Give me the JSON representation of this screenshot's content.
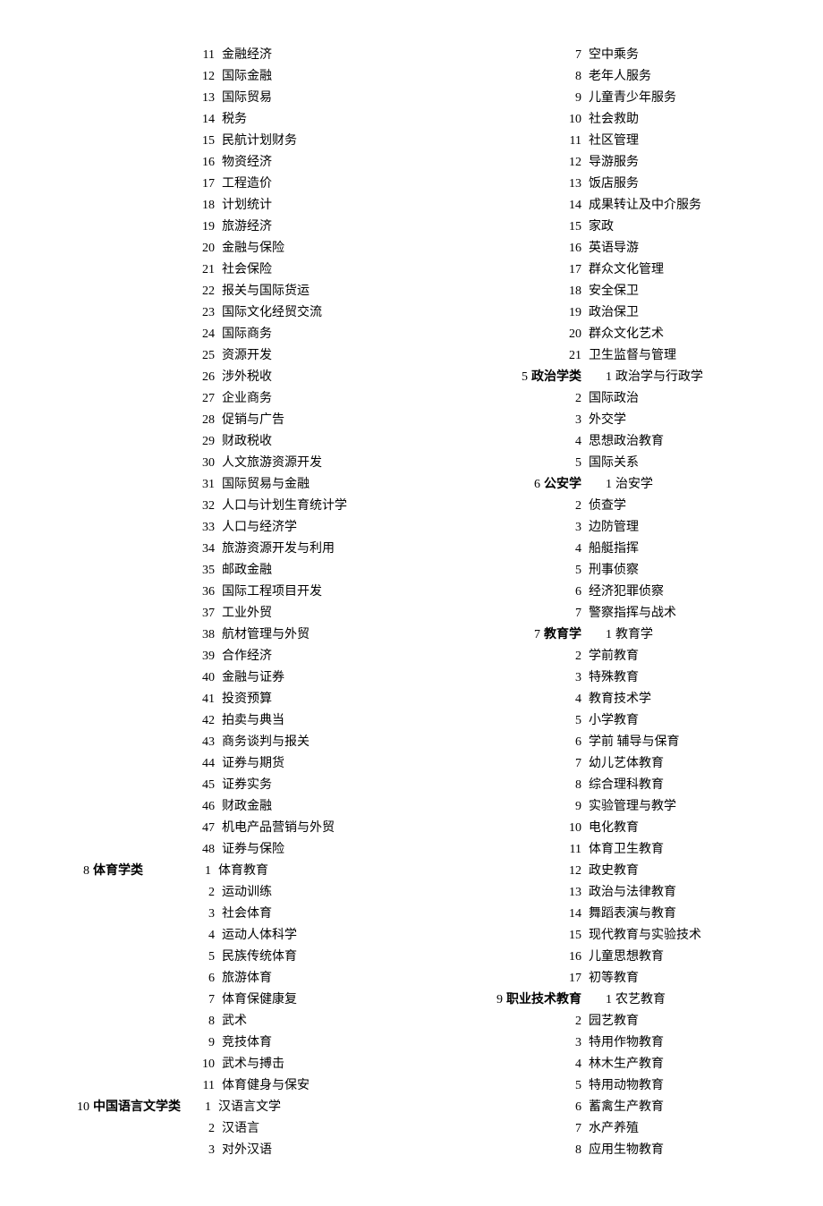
{
  "leftColumn": [
    {
      "type": "item",
      "num": "11",
      "name": "金融经济"
    },
    {
      "type": "item",
      "num": "12",
      "name": "国际金融"
    },
    {
      "type": "item",
      "num": "13",
      "name": "国际贸易"
    },
    {
      "type": "item",
      "num": "14",
      "name": "税务"
    },
    {
      "type": "item",
      "num": "15",
      "name": "民航计划财务"
    },
    {
      "type": "item",
      "num": "16",
      "name": "物资经济"
    },
    {
      "type": "item",
      "num": "17",
      "name": "工程造价"
    },
    {
      "type": "item",
      "num": "18",
      "name": "计划统计"
    },
    {
      "type": "item",
      "num": "19",
      "name": "旅游经济"
    },
    {
      "type": "item",
      "num": "20",
      "name": "金融与保险"
    },
    {
      "type": "item",
      "num": "21",
      "name": "社会保险"
    },
    {
      "type": "item",
      "num": "22",
      "name": "报关与国际货运"
    },
    {
      "type": "item",
      "num": "23",
      "name": "国际文化经贸交流"
    },
    {
      "type": "item",
      "num": "24",
      "name": "国际商务"
    },
    {
      "type": "item",
      "num": "25",
      "name": "资源开发"
    },
    {
      "type": "item",
      "num": "26",
      "name": "涉外税收"
    },
    {
      "type": "item",
      "num": "27",
      "name": "企业商务"
    },
    {
      "type": "item",
      "num": "28",
      "name": "促销与广告"
    },
    {
      "type": "item",
      "num": "29",
      "name": "财政税收"
    },
    {
      "type": "item",
      "num": "30",
      "name": "人文旅游资源开发"
    },
    {
      "type": "item",
      "num": "31",
      "name": "国际贸易与金融"
    },
    {
      "type": "item",
      "num": "32",
      "name": "人口与计划生育统计学"
    },
    {
      "type": "item",
      "num": "33",
      "name": "人口与经济学"
    },
    {
      "type": "item",
      "num": "34",
      "name": "旅游资源开发与利用"
    },
    {
      "type": "item",
      "num": "35",
      "name": "邮政金融"
    },
    {
      "type": "item",
      "num": "36",
      "name": "国际工程项目开发"
    },
    {
      "type": "item",
      "num": "37",
      "name": "工业外贸"
    },
    {
      "type": "item",
      "num": "38",
      "name": "航材管理与外贸"
    },
    {
      "type": "item",
      "num": "39",
      "name": "合作经济"
    },
    {
      "type": "item",
      "num": "40",
      "name": "金融与证券"
    },
    {
      "type": "item",
      "num": "41",
      "name": "投资预算"
    },
    {
      "type": "item",
      "num": "42",
      "name": "拍卖与典当"
    },
    {
      "type": "item",
      "num": "43",
      "name": "商务谈判与报关"
    },
    {
      "type": "item",
      "num": "44",
      "name": "证券与期货"
    },
    {
      "type": "item",
      "num": "45",
      "name": "证券实务"
    },
    {
      "type": "item",
      "num": "46",
      "name": "财政金融"
    },
    {
      "type": "item",
      "num": "47",
      "name": "机电产品营销与外贸"
    },
    {
      "type": "item",
      "num": "48",
      "name": "证券与保险"
    },
    {
      "type": "cat-item",
      "catNum": "8",
      "catName": "体育学类",
      "num": "1",
      "name": "体育教育"
    },
    {
      "type": "item",
      "num": "2",
      "name": "运动训练"
    },
    {
      "type": "item",
      "num": "3",
      "name": "社会体育"
    },
    {
      "type": "item",
      "num": "4",
      "name": "运动人体科学"
    },
    {
      "type": "item",
      "num": "5",
      "name": "民族传统体育"
    },
    {
      "type": "item",
      "num": "6",
      "name": "旅游体育"
    },
    {
      "type": "item",
      "num": "7",
      "name": "体育保健康复"
    },
    {
      "type": "item",
      "num": "8",
      "name": "武术"
    },
    {
      "type": "item",
      "num": "9",
      "name": "竞技体育"
    },
    {
      "type": "item",
      "num": "10",
      "name": "武术与搏击"
    },
    {
      "type": "item",
      "num": "11",
      "name": "体育健身与保安"
    },
    {
      "type": "cat-item",
      "catNum": "10",
      "catName": "中国语言文学类",
      "num": "1",
      "name": "汉语言文学"
    },
    {
      "type": "item",
      "num": "2",
      "name": "汉语言"
    },
    {
      "type": "item",
      "num": "3",
      "name": "对外汉语"
    }
  ],
  "rightColumn": [
    {
      "type": "item",
      "num": "7",
      "name": "空中乘务"
    },
    {
      "type": "item",
      "num": "8",
      "name": "老年人服务"
    },
    {
      "type": "item",
      "num": "9",
      "name": "儿童青少年服务"
    },
    {
      "type": "item",
      "num": "10",
      "name": "社会救助"
    },
    {
      "type": "item",
      "num": "11",
      "name": "社区管理"
    },
    {
      "type": "item",
      "num": "12",
      "name": "导游服务"
    },
    {
      "type": "item",
      "num": "13",
      "name": "饭店服务"
    },
    {
      "type": "item",
      "num": "14",
      "name": "成果转让及中介服务"
    },
    {
      "type": "item",
      "num": "15",
      "name": "家政"
    },
    {
      "type": "item",
      "num": "16",
      "name": "英语导游"
    },
    {
      "type": "item",
      "num": "17",
      "name": "群众文化管理"
    },
    {
      "type": "item",
      "num": "18",
      "name": "安全保卫"
    },
    {
      "type": "item",
      "num": "19",
      "name": "政治保卫"
    },
    {
      "type": "item",
      "num": "20",
      "name": "群众文化艺术"
    },
    {
      "type": "item",
      "num": "21",
      "name": "卫生监督与管理"
    },
    {
      "type": "cat-item",
      "catNum": "5",
      "catName": "政治学类",
      "num": "1",
      "name": "政治学与行政学"
    },
    {
      "type": "item",
      "num": "2",
      "name": "国际政治"
    },
    {
      "type": "item",
      "num": "3",
      "name": "外交学"
    },
    {
      "type": "item",
      "num": "4",
      "name": "思想政治教育"
    },
    {
      "type": "item",
      "num": "5",
      "name": "国际关系"
    },
    {
      "type": "cat-item",
      "catNum": "6",
      "catName": "公安学",
      "num": "1",
      "name": "治安学"
    },
    {
      "type": "item",
      "num": "2",
      "name": "侦查学"
    },
    {
      "type": "item",
      "num": "3",
      "name": "边防管理"
    },
    {
      "type": "item",
      "num": "4",
      "name": "船艇指挥"
    },
    {
      "type": "item",
      "num": "5",
      "name": "刑事侦察"
    },
    {
      "type": "item",
      "num": "6",
      "name": "经济犯罪侦察"
    },
    {
      "type": "item",
      "num": "7",
      "name": "警察指挥与战术"
    },
    {
      "type": "cat-item",
      "catNum": "7",
      "catName": "教育学",
      "num": "1",
      "name": "教育学"
    },
    {
      "type": "item",
      "num": "2",
      "name": "学前教育"
    },
    {
      "type": "item",
      "num": "3",
      "name": "特殊教育"
    },
    {
      "type": "item",
      "num": "4",
      "name": "教育技术学"
    },
    {
      "type": "item",
      "num": "5",
      "name": "小学教育"
    },
    {
      "type": "item",
      "num": "6",
      "name": "学前 辅导与保育"
    },
    {
      "type": "item",
      "num": "7",
      "name": "幼儿艺体教育"
    },
    {
      "type": "item",
      "num": "8",
      "name": "综合理科教育"
    },
    {
      "type": "item",
      "num": "9",
      "name": "实验管理与教学"
    },
    {
      "type": "item",
      "num": "10",
      "name": "电化教育"
    },
    {
      "type": "item",
      "num": "11",
      "name": "体育卫生教育"
    },
    {
      "type": "item",
      "num": "12",
      "name": "政史教育"
    },
    {
      "type": "item",
      "num": "13",
      "name": "政治与法律教育"
    },
    {
      "type": "item",
      "num": "14",
      "name": "舞蹈表演与教育"
    },
    {
      "type": "item",
      "num": "15",
      "name": "现代教育与实验技术"
    },
    {
      "type": "item",
      "num": "16",
      "name": "儿童思想教育"
    },
    {
      "type": "item",
      "num": "17",
      "name": "初等教育"
    },
    {
      "type": "cat-item",
      "catNum": "9",
      "catName": "职业技术教育",
      "num": "1",
      "name": "农艺教育"
    },
    {
      "type": "item",
      "num": "2",
      "name": "园艺教育"
    },
    {
      "type": "item",
      "num": "3",
      "name": "特用作物教育"
    },
    {
      "type": "item",
      "num": "4",
      "name": "林木生产教育"
    },
    {
      "type": "item",
      "num": "5",
      "name": "特用动物教育"
    },
    {
      "type": "item",
      "num": "6",
      "name": "蓄禽生产教育"
    },
    {
      "type": "item",
      "num": "7",
      "name": "水产养殖"
    },
    {
      "type": "item",
      "num": "8",
      "name": "应用生物教育"
    }
  ]
}
